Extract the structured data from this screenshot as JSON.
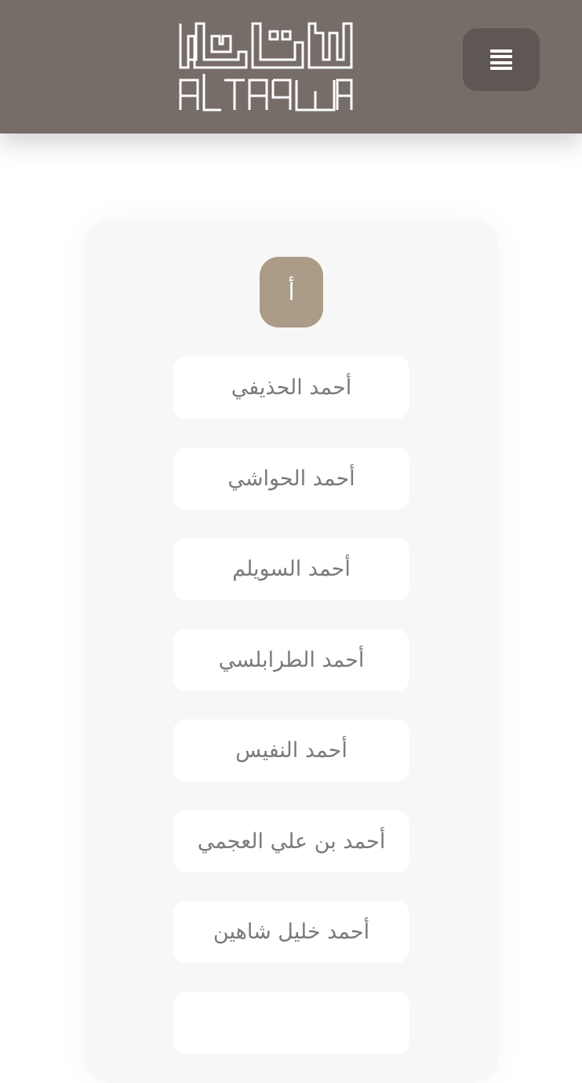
{
  "header": {
    "logo_text_arabic": "التقوى",
    "logo_text_latin": "ALTAQWA",
    "menu_icon": "bars-icon",
    "background_color": "#766d68",
    "menu_button_color": "#5f5753"
  },
  "letter_section": {
    "letter": "أ",
    "badge_color": "#ab9c87"
  },
  "reciters": [
    {
      "name": "أحمد الحذيفي"
    },
    {
      "name": "أحمد الحواشي"
    },
    {
      "name": "أحمد السويلم"
    },
    {
      "name": "أحمد الطرابلسي"
    },
    {
      "name": "أحمد النفيس"
    },
    {
      "name": "أحمد بن علي العجمي"
    },
    {
      "name": "أحمد خليل شاهين"
    },
    {
      "name": ""
    }
  ]
}
